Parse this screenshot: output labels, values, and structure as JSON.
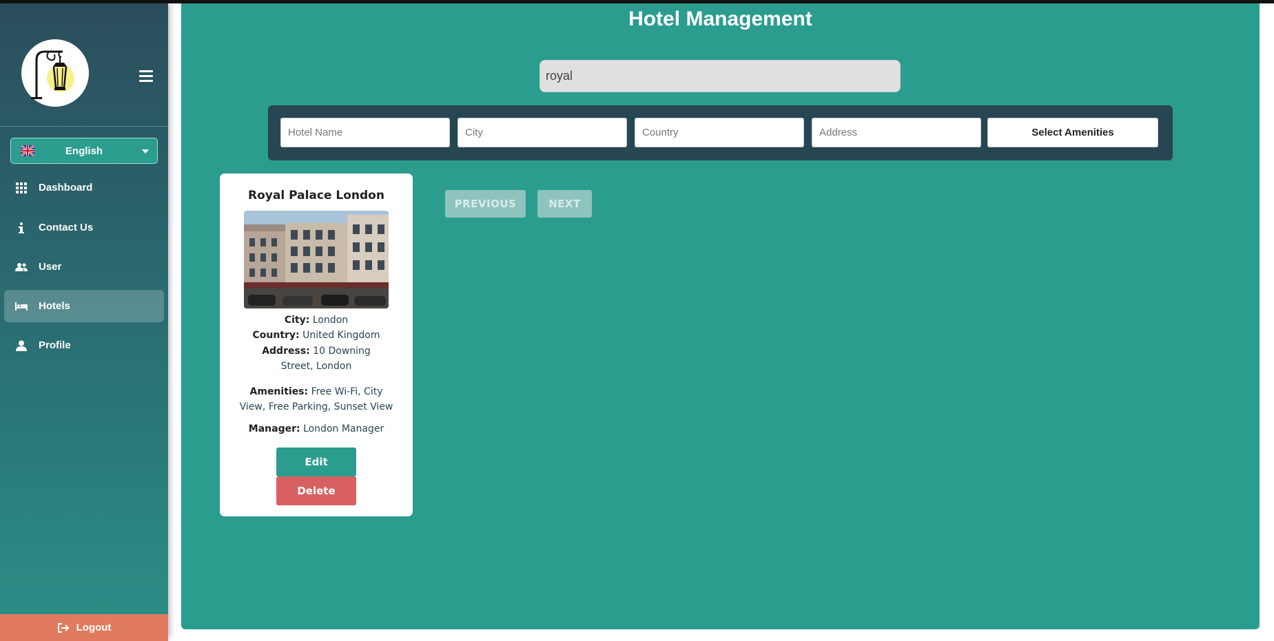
{
  "sidebar": {
    "language": {
      "label": "English",
      "flag": "uk-flag-icon"
    },
    "items": [
      {
        "label": "Dashboard",
        "icon": "grid-icon",
        "active": false
      },
      {
        "label": "Contact Us",
        "icon": "info-icon",
        "active": false
      },
      {
        "label": "User",
        "icon": "users-icon",
        "active": false
      },
      {
        "label": "Hotels",
        "icon": "bed-icon",
        "active": true
      },
      {
        "label": "Profile",
        "icon": "person-icon",
        "active": false
      }
    ],
    "logout_label": "Logout"
  },
  "main": {
    "title": "Hotel Management",
    "search_value": "royal",
    "filters": {
      "hotel_name_placeholder": "Hotel Name",
      "city_placeholder": "City",
      "country_placeholder": "Country",
      "address_placeholder": "Address",
      "amenities_label": "Select Amenities"
    },
    "card": {
      "name": "Royal Palace London",
      "city_label": "City:",
      "city": "London",
      "country_label": "Country:",
      "country": "United Kingdom",
      "address_label": "Address:",
      "address": "10 Downing Street, London",
      "amenities_label": "Amenities:",
      "amenities": "Free Wi-Fi, City View, Free Parking, Sunset View",
      "manager_label": "Manager:",
      "manager": "London Manager",
      "edit_label": "Edit",
      "delete_label": "Delete"
    },
    "pagination": {
      "previous_label": "PREVIOUS",
      "next_label": "NEXT"
    }
  },
  "colors": {
    "main_bg": "#2a9d8f",
    "filter_bar_bg": "#264653",
    "delete_btn": "#d96060",
    "logout_bg": "#e07b5f"
  }
}
